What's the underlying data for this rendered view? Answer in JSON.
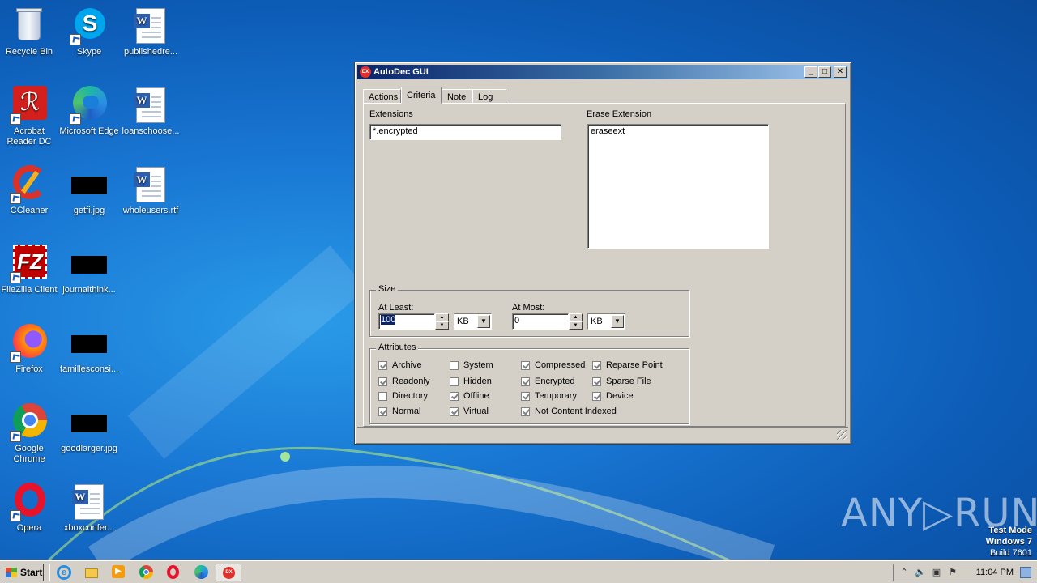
{
  "desktop": {
    "icons": [
      {
        "label": "Recycle Bin",
        "kind": "recycle-bin-icon"
      },
      {
        "label": "Skype",
        "kind": "skype-icon"
      },
      {
        "label": "publishedre...",
        "kind": "word-document-icon"
      },
      {
        "label": "Acrobat Reader DC",
        "kind": "acrobat-icon"
      },
      {
        "label": "Microsoft Edge",
        "kind": "edge-icon"
      },
      {
        "label": "loanschoose...",
        "kind": "word-document-icon"
      },
      {
        "label": "CCleaner",
        "kind": "ccleaner-icon"
      },
      {
        "label": "getfi.jpg",
        "kind": "image-file-icon"
      },
      {
        "label": "wholeusers.rtf",
        "kind": "word-document-icon"
      },
      {
        "label": "FileZilla Client",
        "kind": "filezilla-icon"
      },
      {
        "label": "journalthink...",
        "kind": "image-file-icon"
      },
      {
        "label": "Firefox",
        "kind": "firefox-icon"
      },
      {
        "label": "famillesconsi...",
        "kind": "image-file-icon"
      },
      {
        "label": "Google Chrome",
        "kind": "chrome-icon"
      },
      {
        "label": "goodlarger.jpg",
        "kind": "image-file-icon"
      },
      {
        "label": "Opera",
        "kind": "opera-icon"
      },
      {
        "label": "xboxconfer...",
        "kind": "word-document-icon"
      }
    ]
  },
  "window": {
    "title": "AutoDec GUI",
    "icon_text": "DX",
    "minimize": "_",
    "maximize": "□",
    "close": "✕",
    "tabs": [
      "Actions",
      "Criteria",
      "Note",
      "Log"
    ],
    "active_tab": "Criteria",
    "criteria": {
      "extensions_label": "Extensions",
      "extensions_value": "*.encrypted",
      "erase_label": "Erase Extension",
      "erase_value": "eraseext",
      "size": {
        "title": "Size",
        "at_least_label": "At Least:",
        "at_least_value": "100",
        "at_least_unit": "KB",
        "at_most_label": "At Most:",
        "at_most_value": "0",
        "at_most_unit": "KB"
      },
      "attributes": {
        "title": "Attributes",
        "items": [
          {
            "label": "Archive",
            "checked": true
          },
          {
            "label": "System",
            "checked": false
          },
          {
            "label": "Compressed",
            "checked": true
          },
          {
            "label": "Reparse Point",
            "checked": true
          },
          {
            "label": "Readonly",
            "checked": true
          },
          {
            "label": "Hidden",
            "checked": false
          },
          {
            "label": "Encrypted",
            "checked": true
          },
          {
            "label": "Sparse File",
            "checked": true
          },
          {
            "label": "Directory",
            "checked": false
          },
          {
            "label": "Offline",
            "checked": true
          },
          {
            "label": "Temporary",
            "checked": true
          },
          {
            "label": "Device",
            "checked": true
          },
          {
            "label": "Normal",
            "checked": true
          },
          {
            "label": "Virtual",
            "checked": true
          },
          {
            "label": "Not Content Indexed",
            "checked": true
          }
        ]
      }
    }
  },
  "taskbar": {
    "start_label": "Start",
    "quick_launch": [
      "ie-icon",
      "explorer-icon",
      "media-player-icon",
      "chrome-icon",
      "opera-icon",
      "edge-icon"
    ],
    "running_app_icon": "autodec-icon",
    "clock": "11:04 PM"
  },
  "watermark": "ANY▷RUN",
  "test_mode": {
    "line1": "Test Mode",
    "line2": "Windows 7",
    "line3": "Build 7601"
  },
  "colors": {
    "titlebar_start": "#0a246a",
    "titlebar_end": "#a6caf0",
    "dialog_face": "#d4d0c8",
    "desktop": "#1978d4"
  }
}
